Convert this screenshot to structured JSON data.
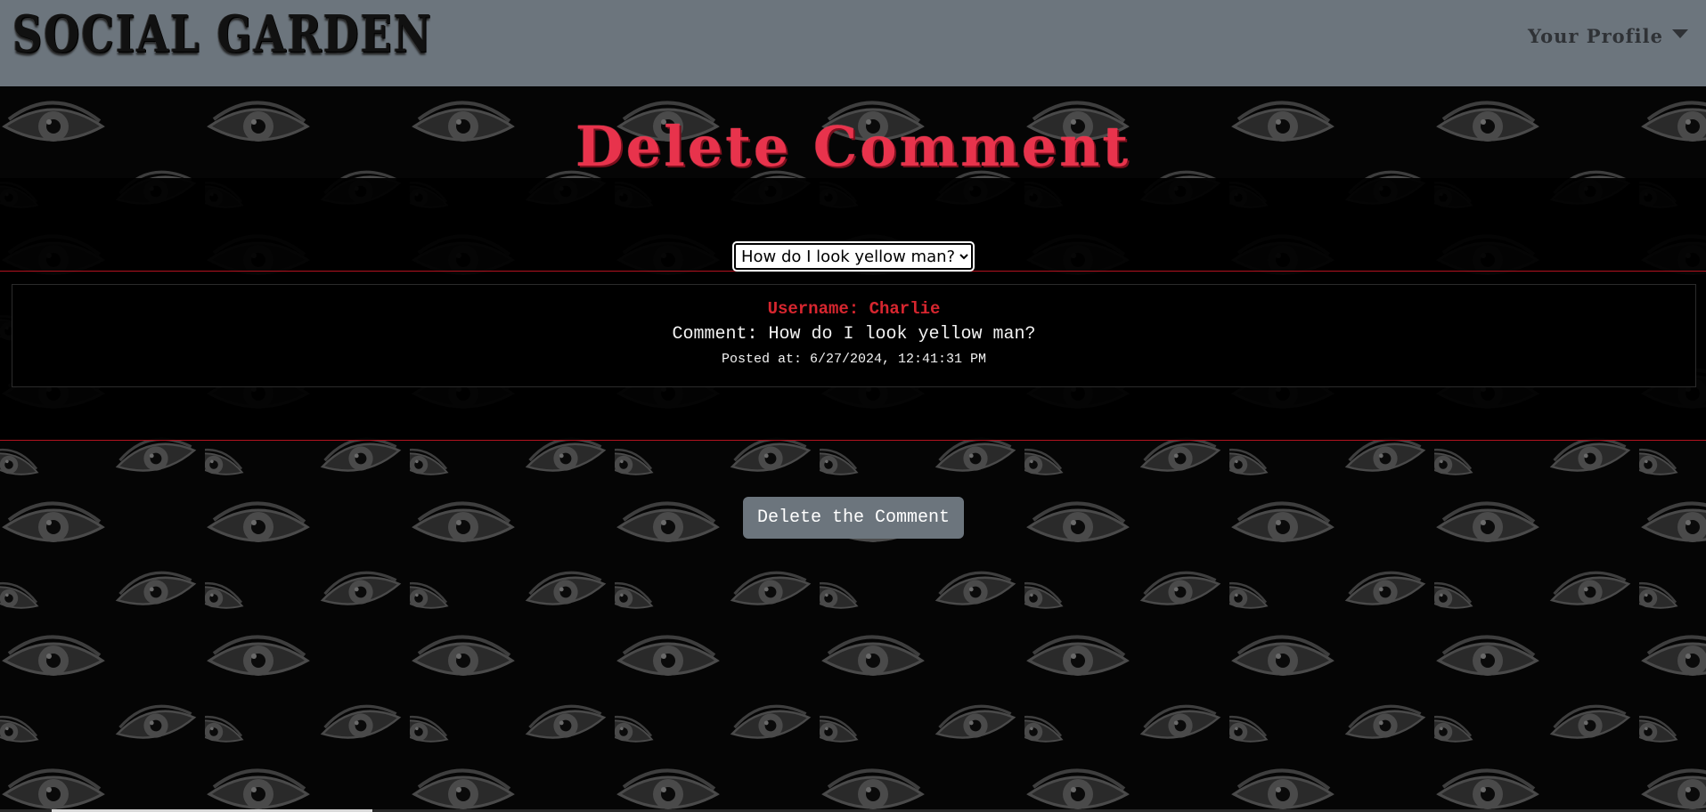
{
  "header": {
    "brand": "SOCIAL GARDEN",
    "profile_label": "Your Profile"
  },
  "page": {
    "title": "Delete Comment"
  },
  "comment_select": {
    "selected": "How do I look yellow man?",
    "options": [
      "How do I look yellow man?"
    ]
  },
  "comment": {
    "username": "Username: Charlie",
    "text": "Comment: How do I look yellow man?",
    "posted_at": "Posted at: 6/27/2024, 12:41:31 PM"
  },
  "actions": {
    "delete_label": "Delete the Comment"
  },
  "colors": {
    "navbar": "#6c757d",
    "title": "#e8334c",
    "accent_red": "#d7262f",
    "button": "#6c757d"
  }
}
